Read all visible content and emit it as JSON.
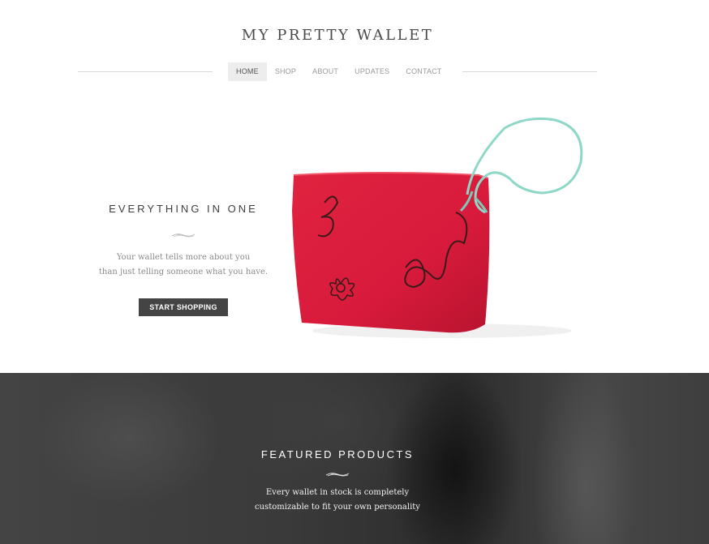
{
  "header": {
    "title": "MY PRETTY WALLET"
  },
  "nav": {
    "items": [
      "HOME",
      "SHOP",
      "ABOUT",
      "UPDATES",
      "CONTACT"
    ],
    "active": "HOME"
  },
  "hero": {
    "title": "EVERYTHING IN ONE",
    "text_line1": "Your wallet tells more about you",
    "text_line2": "than just telling someone what you have.",
    "button_label": "START SHOPPING",
    "button_color": "#444444",
    "image_icon": "red-wallet-with-teal-strap"
  },
  "featured": {
    "title": "FEATURED PRODUCTS",
    "text_line1": "Every wallet in stock is completely",
    "text_line2": "customizable to fit your own personality"
  },
  "colors": {
    "wallet_red": "#d81a3c",
    "strap_teal": "#8fd8c8",
    "text_dark": "#3e3e3e"
  }
}
